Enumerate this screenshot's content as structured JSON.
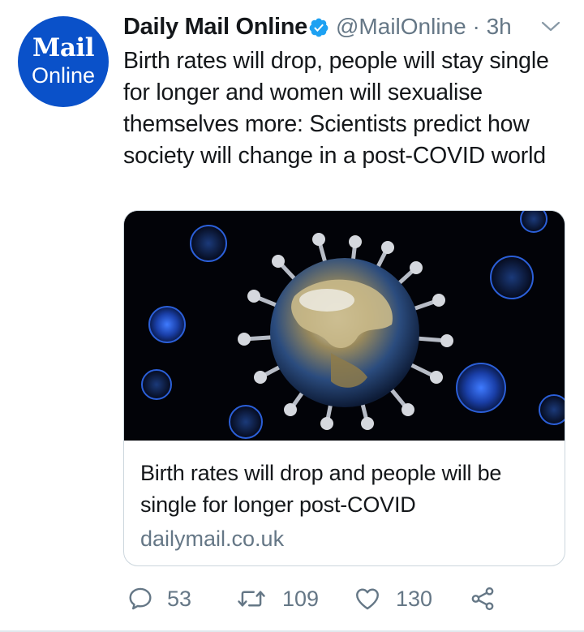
{
  "tweet": {
    "avatar": {
      "line1": "Mail",
      "line2": "Online"
    },
    "author_name": "Daily Mail Online",
    "verified": true,
    "handle": "@MailOnline",
    "separator": "·",
    "time": "3h",
    "text": "Birth rates will drop, people will stay single for longer and women will sexualise themselves more: Scientists predict how society will change in a post-COVID world",
    "card": {
      "image_description": "coronavirus-globe-icon",
      "title": "Birth rates will drop and people will be single for longer post-COVID",
      "domain": "dailymail.co.uk"
    },
    "actions": {
      "replies": "53",
      "retweets": "109",
      "likes": "130"
    }
  },
  "colors": {
    "text": "#14171a",
    "muted": "#657786",
    "verified": "#1da1f2",
    "brand": "#0a51c9",
    "border": "#ccd6dd"
  }
}
